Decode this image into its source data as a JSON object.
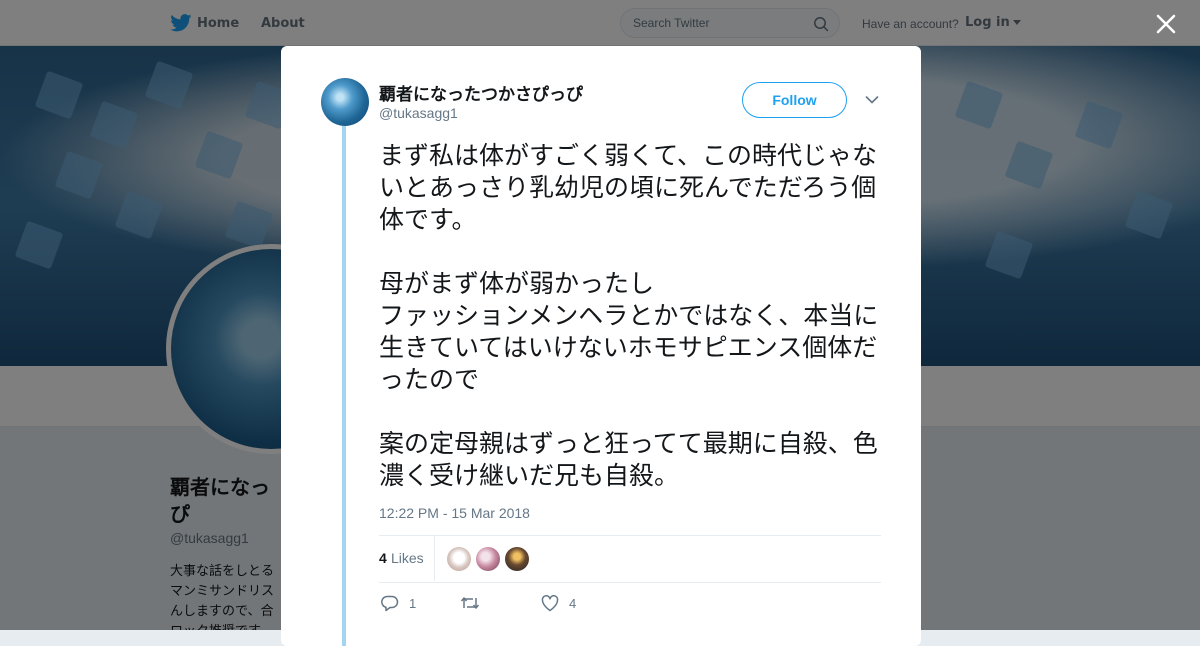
{
  "topnav": {
    "home_label": "Home",
    "about_label": "About",
    "search_placeholder": "Search Twitter",
    "have_account": "Have an account?",
    "login_label": "Log in"
  },
  "background_profile": {
    "name_part1": "覇者になっ",
    "name_part2": "ぴ",
    "handle": "@tukasagg1",
    "bio": "大事な話をしとる\nマンミサンドリス\nんしますので、合\nロック推奨です。"
  },
  "tweet": {
    "display_name": "覇者になったつかさぴっぴ",
    "username": "@tukasagg1",
    "follow_label": "Follow",
    "text": "まず私は体がすごく弱くて、この時代じゃないとあっさり乳幼児の頃に死んでただろう個体です。\n\n母がまず体が弱かったし\nファッションメンヘラとかではなく、本当に生きていてはいけないホモサピエンス個体だったので\n\n案の定母親はずっと狂ってて最期に自殺、色濃く受け継いだ兄も自殺。",
    "timestamp": "12:22 PM - 15 Mar 2018",
    "likes_count": "4",
    "likes_label": "Likes",
    "reply_count": "1",
    "like_count": "4"
  },
  "colors": {
    "accent": "#1da1f2",
    "thread_line": "#a3d4f2",
    "muted_text": "#657786"
  }
}
